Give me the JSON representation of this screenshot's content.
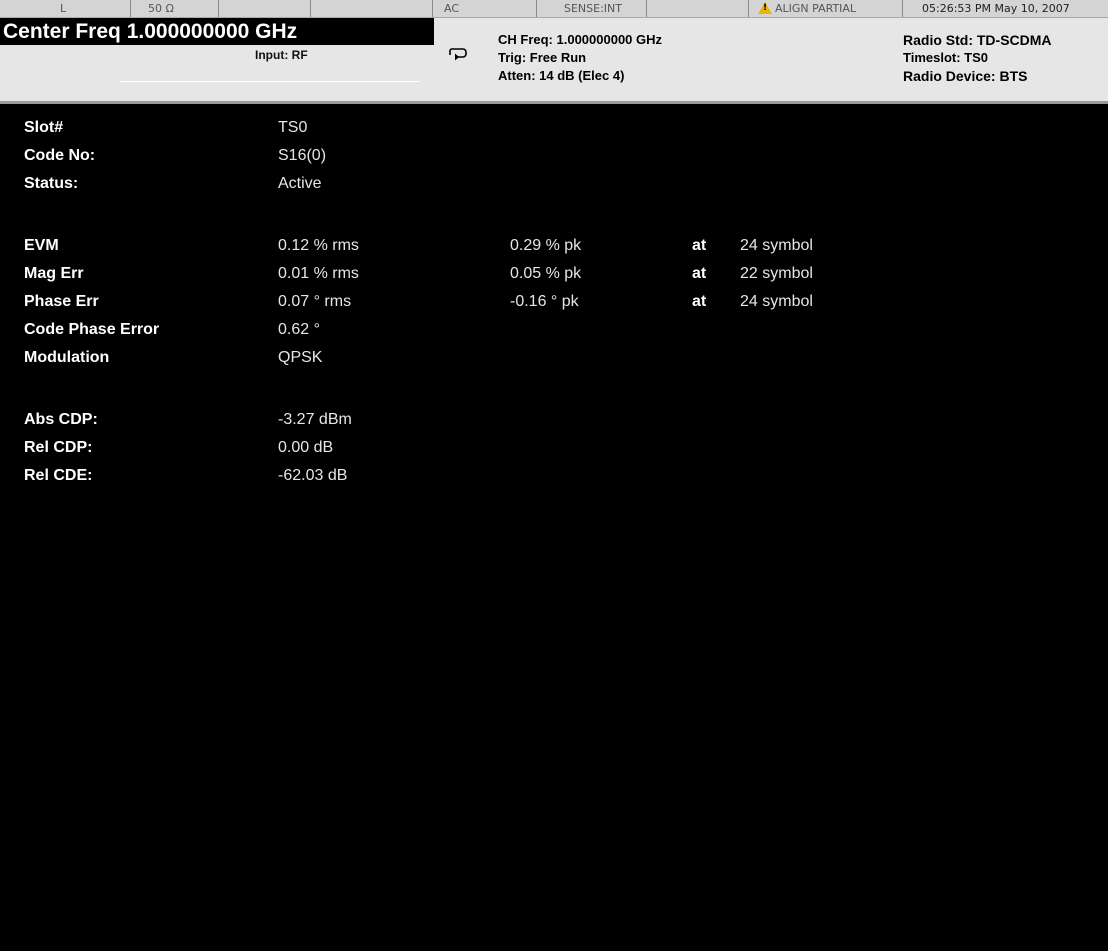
{
  "status_bar": {
    "coupling": "L",
    "impedance": "50 Ω",
    "ac": "AC",
    "sense": "SENSE:INT",
    "align": "ALIGN PARTIAL",
    "datetime": "05:26:53 PM May 10, 2007",
    "warning_icon": "warning-triangle-icon"
  },
  "header": {
    "center_freq": "Center Freq  1.000000000 GHz",
    "input": "Input: RF",
    "ch_freq": "CH Freq: 1.000000000 GHz",
    "trig": "Trig: Free Run",
    "atten": "Atten: 14 dB (Elec 4)",
    "radio_std": "Radio Std: TD-SCDMA",
    "timeslot": "Timeslot: TS0",
    "radio_device": "Radio Device: BTS",
    "trigger_icon": "trigger-loop-icon"
  },
  "info": [
    {
      "label": "Slot#",
      "value": "TS0"
    },
    {
      "label": "Code No:",
      "value": "S16(0)"
    },
    {
      "label": "Status:",
      "value": "Active"
    }
  ],
  "measurements": [
    {
      "label": "EVM",
      "rms": "0.12 % rms",
      "pk": "0.29 % pk",
      "at": "at",
      "symbol": "24 symbol"
    },
    {
      "label": "Mag Err",
      "rms": "0.01 % rms",
      "pk": "0.05 % pk",
      "at": "at",
      "symbol": "22 symbol"
    },
    {
      "label": "Phase Err",
      "rms": "0.07 ° rms",
      "pk": "-0.16 ° pk",
      "at": "at",
      "symbol": "24 symbol"
    },
    {
      "label": "Code Phase Error",
      "rms": "0.62 °"
    },
    {
      "label": "Modulation",
      "rms": "QPSK"
    }
  ],
  "cdp": [
    {
      "label": "Abs CDP:",
      "value": "-3.27 dBm"
    },
    {
      "label": "Rel CDP:",
      "value": "0.00 dB"
    },
    {
      "label": "Rel CDE:",
      "value": "-62.03 dB"
    }
  ],
  "colors": {
    "background": "#000000",
    "header_bg": "#e6e6e6",
    "status_bg": "#d4d4d4",
    "warning": "#e8b800"
  }
}
